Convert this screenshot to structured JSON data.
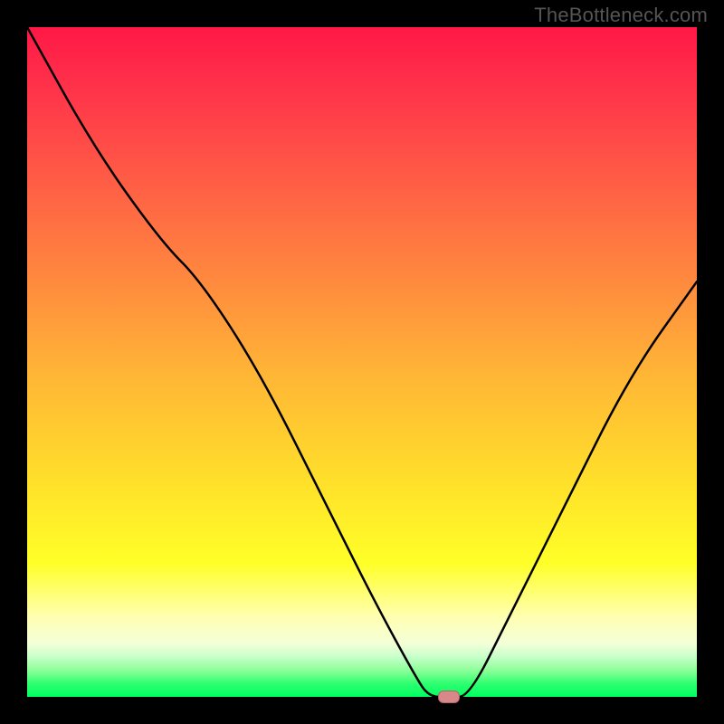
{
  "watermark": "TheBottleneck.com",
  "chart_data": {
    "type": "line",
    "title": "",
    "xlabel": "",
    "ylabel": "",
    "xlim": [
      0,
      100
    ],
    "ylim": [
      0,
      100
    ],
    "grid": false,
    "series": [
      {
        "name": "curve",
        "x": [
          0,
          10,
          20,
          26,
          35,
          45,
          52,
          58,
          60,
          63,
          66,
          72,
          80,
          90,
          100
        ],
        "values": [
          100,
          82,
          68,
          62,
          48,
          28,
          14,
          3,
          0,
          0,
          0,
          12,
          28,
          48,
          62
        ]
      }
    ],
    "marker": {
      "x": 63,
      "y": 0
    },
    "gradient_stops": [
      {
        "pos": 0,
        "color": "#ff1846"
      },
      {
        "pos": 22,
        "color": "#ff5a46"
      },
      {
        "pos": 52,
        "color": "#ffb636"
      },
      {
        "pos": 80,
        "color": "#ffff28"
      },
      {
        "pos": 96,
        "color": "#8eff9a"
      },
      {
        "pos": 100,
        "color": "#00ff62"
      }
    ]
  }
}
